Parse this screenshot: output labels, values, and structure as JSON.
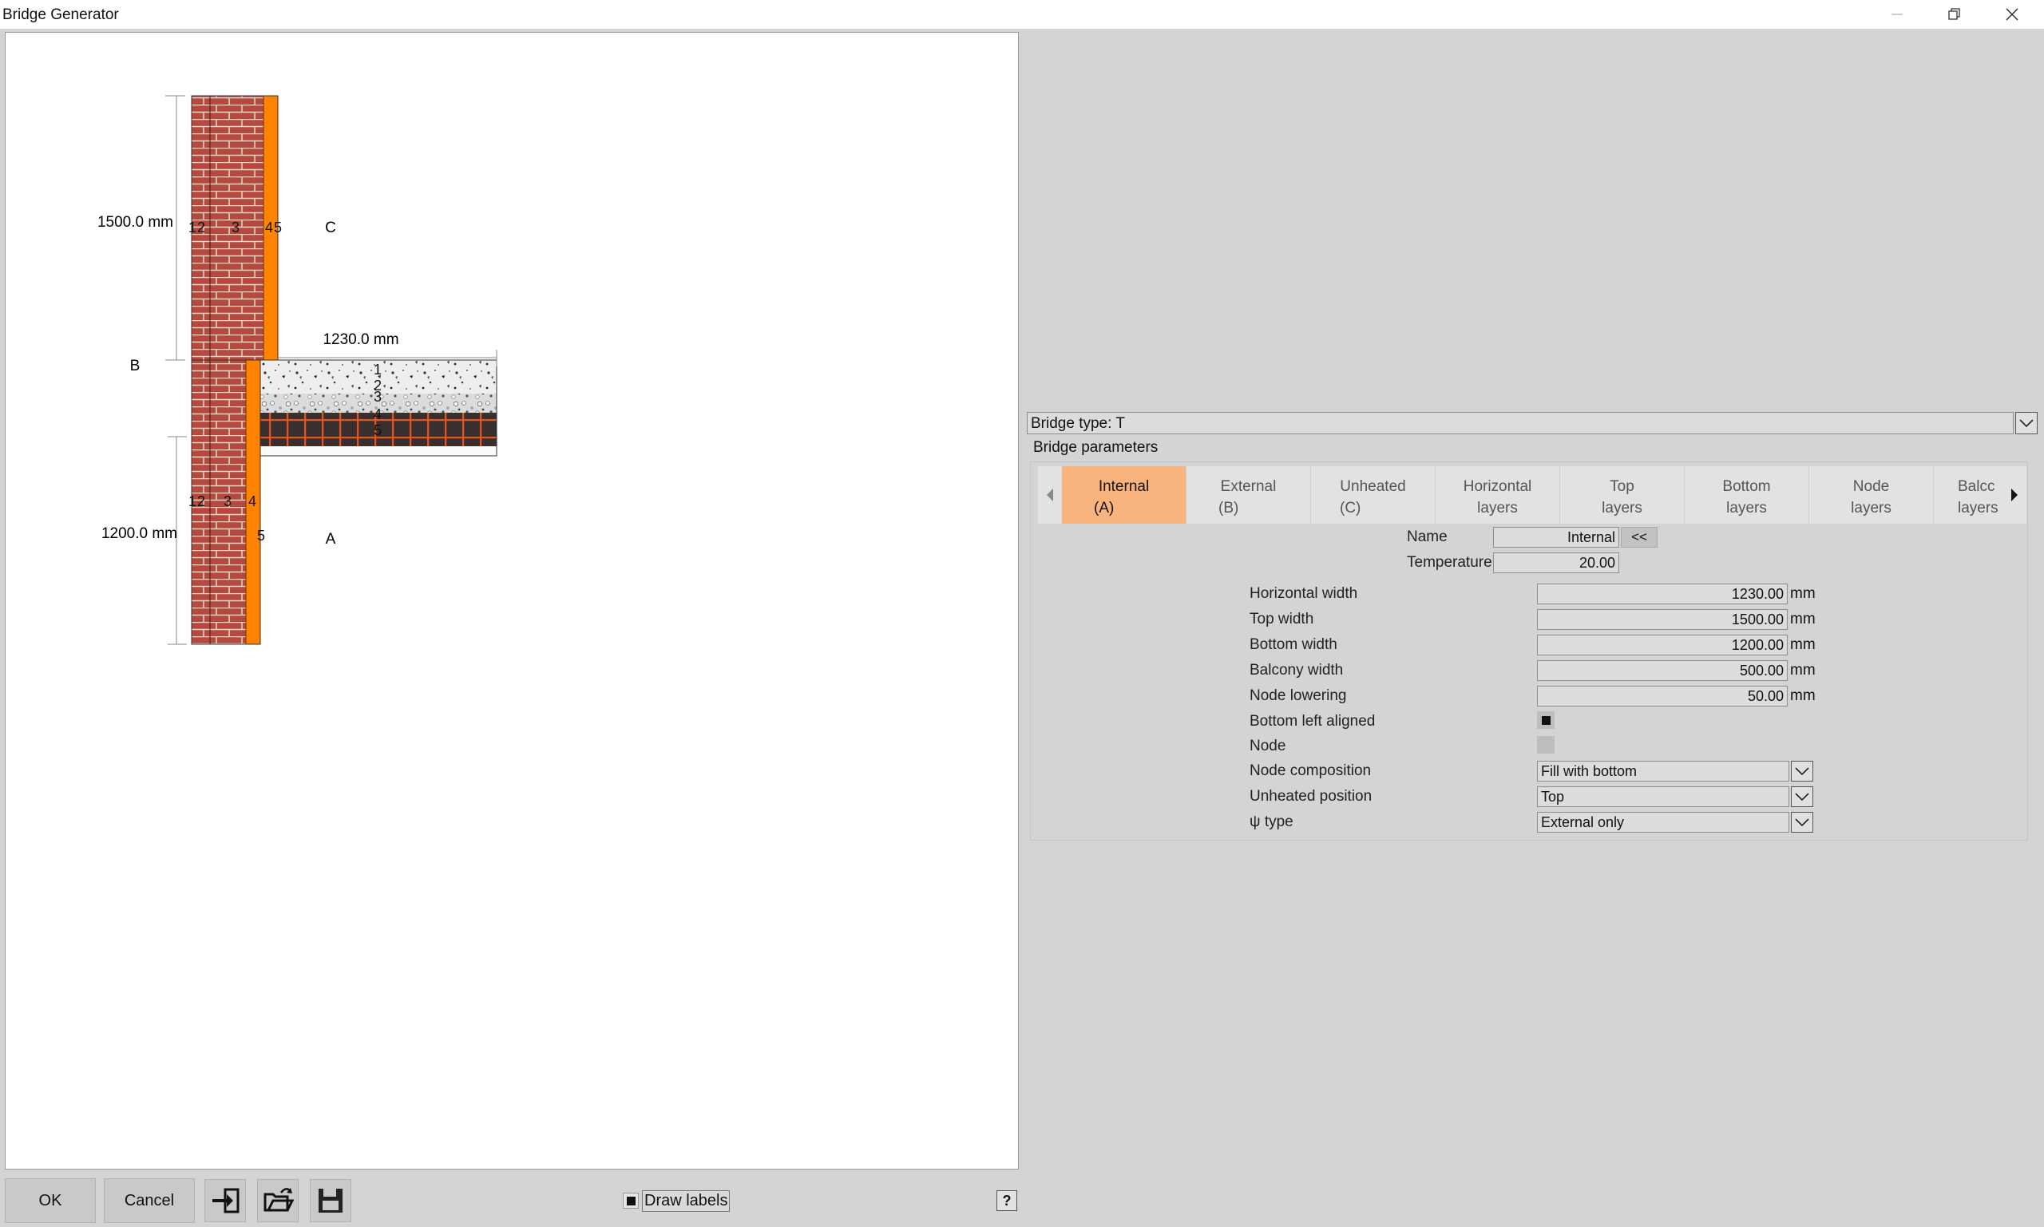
{
  "window": {
    "title": "Bridge Generator"
  },
  "drawing": {
    "dim_top": "1500.0 mm",
    "dim_horizontal": "1230.0 mm",
    "dim_bottom": "1200.0 mm",
    "region_a": "A",
    "region_b": "B",
    "region_c": "C",
    "top_layer_labels": [
      "1",
      "2",
      "3",
      "4",
      "5"
    ],
    "bottom_layer_labels": [
      "1",
      "2",
      "3",
      "4",
      "5"
    ],
    "slab_layer_labels": [
      "1",
      "2",
      "3",
      "4",
      "5"
    ],
    "colors": {
      "brick": "#b5493d",
      "mortar": "#e8d8cc",
      "insulation": "#ff8300",
      "concrete": "#eeeeee",
      "grid_bg": "#3a2f2f",
      "grid_line": "#e8541d"
    }
  },
  "footer": {
    "ok_label": "OK",
    "cancel_label": "Cancel",
    "draw_labels_label": "Draw labels",
    "draw_labels_checked": true,
    "help_label": "?"
  },
  "bridge_type": {
    "value": "Bridge type: T"
  },
  "params": {
    "title": "Bridge parameters",
    "tabs": [
      {
        "line1": "Internal",
        "line2": "(A)",
        "active": true
      },
      {
        "line1": "External",
        "line2": "(B)"
      },
      {
        "line1": "Unheated",
        "line2": "(C)"
      },
      {
        "line1": "Horizontal",
        "line2": "layers"
      },
      {
        "line1": "Top",
        "line2": "layers"
      },
      {
        "line1": "Bottom",
        "line2": "layers"
      },
      {
        "line1": "Node",
        "line2": "layers"
      },
      {
        "line1": "Balcc",
        "line2": "layers"
      }
    ],
    "name_label": "Name",
    "name_value": "Internal",
    "name_button": "<<",
    "temperature_label": "Temperature",
    "temperature_value": "20.00",
    "horizontal_width_label": "Horizontal width",
    "horizontal_width_value": "1230.00",
    "top_width_label": "Top width",
    "top_width_value": "1500.00",
    "bottom_width_label": "Bottom width",
    "bottom_width_value": "1200.00",
    "balcony_width_label": "Balcony width",
    "balcony_width_value": "500.00",
    "node_lowering_label": "Node lowering",
    "node_lowering_value": "50.00",
    "unit": "mm",
    "bottom_left_aligned_label": "Bottom left aligned",
    "bottom_left_aligned_checked": true,
    "node_label": "Node",
    "node_checked": false,
    "node_composition_label": "Node composition",
    "node_composition_value": "Fill with bottom",
    "unheated_position_label": "Unheated position",
    "unheated_position_value": "Top",
    "psi_type_label": "ψ type",
    "psi_type_value": "External only"
  }
}
